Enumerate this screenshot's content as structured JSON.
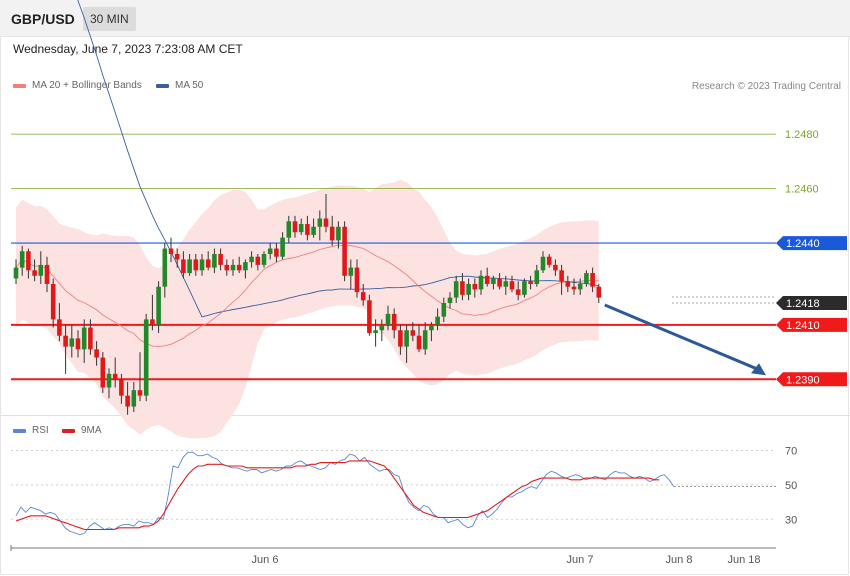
{
  "header": {
    "symbol": "GBP/USD",
    "timeframe": "30 MIN"
  },
  "datetime": "Wednesday, June 7, 2023 7:23:08 AM CET",
  "legend": {
    "ma20": {
      "label": "MA 20 + Bollinger Bands",
      "color": "#f08080"
    },
    "ma50": {
      "label": "MA 50",
      "color": "#3a5f9c"
    }
  },
  "credit": "Research © 2023 Trading Central",
  "rsi_legend": {
    "rsi": {
      "label": "RSI",
      "color": "#5b86d6"
    },
    "ma9": {
      "label": "9MA",
      "color": "#e01e1e"
    }
  },
  "x_labels": [
    "Jun 6",
    "Jun 7",
    "Jun 8",
    "Jun 18"
  ],
  "colors": {
    "up": "#22882a",
    "down": "#e01818",
    "band": "#fde2e2",
    "projection": "#2d5a96"
  },
  "chart_data": [
    {
      "type": "candlestick",
      "title": "GBP/USD 30 MIN",
      "ylim": [
        1.2378,
        1.2505
      ],
      "levels": [
        {
          "price": 1.248,
          "label": "1.2480",
          "kind": "target",
          "color": "#7aaa1e"
        },
        {
          "price": 1.246,
          "label": "1.2460",
          "kind": "target",
          "color": "#7aaa1e"
        },
        {
          "price": 1.244,
          "label": "1.2440",
          "kind": "pivot",
          "color": "#1a5ad8"
        },
        {
          "price": 1.2418,
          "label": "1.2418",
          "kind": "last",
          "color": "#2b2b2b"
        },
        {
          "price": 1.241,
          "label": "1.2410",
          "kind": "support",
          "color": "#f01a1a"
        },
        {
          "price": 1.239,
          "label": "1.2390",
          "kind": "support",
          "color": "#f01a1a"
        }
      ],
      "ohlc": [
        [
          1.2427,
          1.2434,
          1.2425,
          1.2431
        ],
        [
          1.2431,
          1.2439,
          1.2428,
          1.2437
        ],
        [
          1.2437,
          1.2438,
          1.2427,
          1.243
        ],
        [
          1.243,
          1.2434,
          1.2426,
          1.2428
        ],
        [
          1.2428,
          1.2437,
          1.2425,
          1.2432
        ],
        [
          1.2432,
          1.2435,
          1.2422,
          1.2425
        ],
        [
          1.2425,
          1.2427,
          1.2409,
          1.2412
        ],
        [
          1.2412,
          1.2418,
          1.2404,
          1.2406
        ],
        [
          1.2406,
          1.241,
          1.2392,
          1.2402
        ],
        [
          1.2402,
          1.241,
          1.2398,
          1.2405
        ],
        [
          1.2405,
          1.2408,
          1.2398,
          1.2401
        ],
        [
          1.2401,
          1.2412,
          1.2396,
          1.2409
        ],
        [
          1.2409,
          1.2412,
          1.2399,
          1.2401
        ],
        [
          1.2401,
          1.2404,
          1.2395,
          1.2398
        ],
        [
          1.2398,
          1.24,
          1.2385,
          1.2387
        ],
        [
          1.2387,
          1.2394,
          1.2383,
          1.2392
        ],
        [
          1.2392,
          1.2398,
          1.2387,
          1.239
        ],
        [
          1.239,
          1.2392,
          1.2381,
          1.2384
        ],
        [
          1.2384,
          1.2389,
          1.2377,
          1.238
        ],
        [
          1.238,
          1.2389,
          1.2378,
          1.2386
        ],
        [
          1.2386,
          1.24,
          1.2382,
          1.2384
        ],
        [
          1.2384,
          1.2414,
          1.2382,
          1.2412
        ],
        [
          1.2412,
          1.2421,
          1.2408,
          1.241
        ],
        [
          1.241,
          1.2426,
          1.2407,
          1.2424
        ],
        [
          1.2424,
          1.244,
          1.242,
          1.2438
        ],
        [
          1.2438,
          1.2442,
          1.2433,
          1.2436
        ],
        [
          1.2436,
          1.2438,
          1.2431,
          1.2434
        ],
        [
          1.2434,
          1.2437,
          1.2427,
          1.2429
        ],
        [
          1.2429,
          1.2436,
          1.2428,
          1.2434
        ],
        [
          1.2434,
          1.2436,
          1.2428,
          1.243
        ],
        [
          1.243,
          1.2436,
          1.2428,
          1.2434
        ],
        [
          1.2434,
          1.2437,
          1.243,
          1.2431
        ],
        [
          1.2431,
          1.2438,
          1.2429,
          1.2436
        ],
        [
          1.2436,
          1.2438,
          1.243,
          1.2432
        ],
        [
          1.2432,
          1.2434,
          1.2428,
          1.243
        ],
        [
          1.243,
          1.2434,
          1.2428,
          1.2432
        ],
        [
          1.2432,
          1.2435,
          1.2429,
          1.243
        ],
        [
          1.243,
          1.2434,
          1.2427,
          1.2433
        ],
        [
          1.2433,
          1.2437,
          1.2431,
          1.2435
        ],
        [
          1.2435,
          1.2436,
          1.243,
          1.2432
        ],
        [
          1.2432,
          1.2437,
          1.2431,
          1.2436
        ],
        [
          1.2436,
          1.244,
          1.2434,
          1.2438
        ],
        [
          1.2438,
          1.244,
          1.2433,
          1.2435
        ],
        [
          1.2435,
          1.2444,
          1.2434,
          1.2442
        ],
        [
          1.2442,
          1.245,
          1.244,
          1.2448
        ],
        [
          1.2448,
          1.245,
          1.2442,
          1.2444
        ],
        [
          1.2444,
          1.2449,
          1.2443,
          1.2447
        ],
        [
          1.2447,
          1.245,
          1.2441,
          1.2443
        ],
        [
          1.2443,
          1.2449,
          1.2442,
          1.2446
        ],
        [
          1.2446,
          1.2452,
          1.2441,
          1.2449
        ],
        [
          1.2449,
          1.2458,
          1.2444,
          1.2446
        ],
        [
          1.2446,
          1.245,
          1.2439,
          1.2441
        ],
        [
          1.2441,
          1.2448,
          1.2438,
          1.2446
        ],
        [
          1.2446,
          1.2448,
          1.2426,
          1.2428
        ],
        [
          1.2428,
          1.2434,
          1.2423,
          1.2431
        ],
        [
          1.2431,
          1.2434,
          1.242,
          1.2422
        ],
        [
          1.2422,
          1.2425,
          1.2417,
          1.2419
        ],
        [
          1.2419,
          1.2421,
          1.2406,
          1.2407
        ],
        [
          1.2407,
          1.2412,
          1.2402,
          1.2408
        ],
        [
          1.2408,
          1.2412,
          1.2404,
          1.241
        ],
        [
          1.241,
          1.2417,
          1.2408,
          1.2414
        ],
        [
          1.2414,
          1.2416,
          1.2405,
          1.2408
        ],
        [
          1.2408,
          1.241,
          1.2399,
          1.2402
        ],
        [
          1.2402,
          1.241,
          1.2396,
          1.2408
        ],
        [
          1.2408,
          1.2411,
          1.2404,
          1.2406
        ],
        [
          1.2406,
          1.241,
          1.24,
          1.2401
        ],
        [
          1.2401,
          1.2411,
          1.2399,
          1.2408
        ],
        [
          1.2408,
          1.2411,
          1.2404,
          1.241
        ],
        [
          1.241,
          1.2416,
          1.2408,
          1.2413
        ],
        [
          1.2413,
          1.242,
          1.2411,
          1.2418
        ],
        [
          1.2418,
          1.2422,
          1.2416,
          1.242
        ],
        [
          1.242,
          1.2428,
          1.2418,
          1.2426
        ],
        [
          1.2426,
          1.2429,
          1.2419,
          1.2421
        ],
        [
          1.2421,
          1.2427,
          1.2419,
          1.2425
        ],
        [
          1.2425,
          1.2427,
          1.242,
          1.2423
        ],
        [
          1.2423,
          1.243,
          1.2421,
          1.2428
        ],
        [
          1.2428,
          1.2431,
          1.2424,
          1.2425
        ],
        [
          1.2425,
          1.2428,
          1.2423,
          1.2427
        ],
        [
          1.2427,
          1.2429,
          1.2423,
          1.2424
        ],
        [
          1.2424,
          1.2428,
          1.2421,
          1.2426
        ],
        [
          1.2426,
          1.2428,
          1.2422,
          1.2423
        ],
        [
          1.2423,
          1.2426,
          1.2419,
          1.2421
        ],
        [
          1.2421,
          1.2427,
          1.242,
          1.2426
        ],
        [
          1.2426,
          1.2428,
          1.2423,
          1.2425
        ],
        [
          1.2425,
          1.2432,
          1.2424,
          1.243
        ],
        [
          1.243,
          1.2437,
          1.2429,
          1.2435
        ],
        [
          1.2435,
          1.2436,
          1.2431,
          1.2432
        ],
        [
          1.2432,
          1.2434,
          1.2428,
          1.243
        ],
        [
          1.243,
          1.2432,
          1.2421,
          1.2426
        ],
        [
          1.2426,
          1.2428,
          1.2422,
          1.2424
        ],
        [
          1.2424,
          1.2427,
          1.2421,
          1.2423
        ],
        [
          1.2423,
          1.2427,
          1.2421,
          1.2425
        ],
        [
          1.2425,
          1.243,
          1.2424,
          1.2429
        ],
        [
          1.2429,
          1.2431,
          1.2422,
          1.2424
        ],
        [
          1.2424,
          1.2425,
          1.2418,
          1.242
        ]
      ],
      "projection": {
        "from": 1.2418,
        "to": 1.239
      }
    },
    {
      "type": "line",
      "title": "RSI",
      "ylim": [
        15,
        75
      ],
      "yticks": [
        30,
        50,
        70
      ],
      "series": [
        {
          "name": "RSI",
          "values": [
            32,
            37,
            34,
            37,
            36,
            35,
            33,
            34,
            33,
            29,
            25,
            23,
            22,
            21,
            22,
            26,
            28,
            26,
            24,
            25,
            24,
            26,
            27,
            27,
            26,
            29,
            28,
            28,
            27,
            31,
            30,
            44,
            61,
            60,
            66,
            69,
            69,
            67,
            67,
            68,
            66,
            65,
            62,
            61,
            60,
            60,
            59,
            58,
            59,
            59,
            57,
            58,
            59,
            58,
            59,
            61,
            61,
            63,
            64,
            62,
            61,
            60,
            59,
            60,
            63,
            62,
            64,
            65,
            68,
            67,
            64,
            66,
            62,
            60,
            58,
            59,
            59,
            56,
            55,
            46,
            40,
            37,
            35,
            38,
            37,
            33,
            31,
            31,
            28,
            29,
            30,
            27,
            25,
            26,
            32,
            35,
            31,
            33,
            36,
            40,
            43,
            43,
            45,
            46,
            48,
            49,
            48,
            52,
            56,
            58,
            57,
            55,
            54,
            55,
            56,
            55,
            53,
            54,
            55,
            54,
            53,
            56,
            58,
            57,
            57,
            55,
            54,
            55,
            54,
            52,
            53,
            55,
            56,
            53,
            49
          ]
        },
        {
          "name": "9MA",
          "values": [
            29,
            30,
            31,
            32,
            32,
            32,
            32,
            31,
            30,
            29,
            28,
            27,
            26,
            25,
            24,
            24,
            24,
            24,
            24,
            24,
            24,
            25,
            25,
            25,
            25,
            25,
            26,
            26,
            27,
            29,
            33,
            38,
            43,
            48,
            52,
            56,
            59,
            61,
            61,
            62,
            62,
            62,
            62,
            61,
            61,
            61,
            61,
            60,
            60,
            60,
            60,
            60,
            60,
            60,
            60,
            60,
            60,
            61,
            61,
            61,
            62,
            62,
            63,
            63,
            63,
            63,
            63,
            63,
            64,
            64,
            64,
            64,
            64,
            63,
            62,
            61,
            58,
            54,
            50,
            46,
            42,
            38,
            36,
            34,
            33,
            32,
            31,
            31,
            31,
            31,
            31,
            31,
            31,
            32,
            33,
            34,
            35,
            37,
            39,
            41,
            43,
            45,
            47,
            49,
            50,
            52,
            53,
            54,
            54,
            54,
            54,
            54,
            54,
            53,
            53,
            53,
            54,
            54,
            54,
            54,
            54,
            54,
            54,
            54,
            54,
            54,
            54,
            54,
            54,
            54,
            53,
            53
          ]
        }
      ],
      "last": {
        "rsi": 49,
        "ma9": 53
      }
    }
  ]
}
